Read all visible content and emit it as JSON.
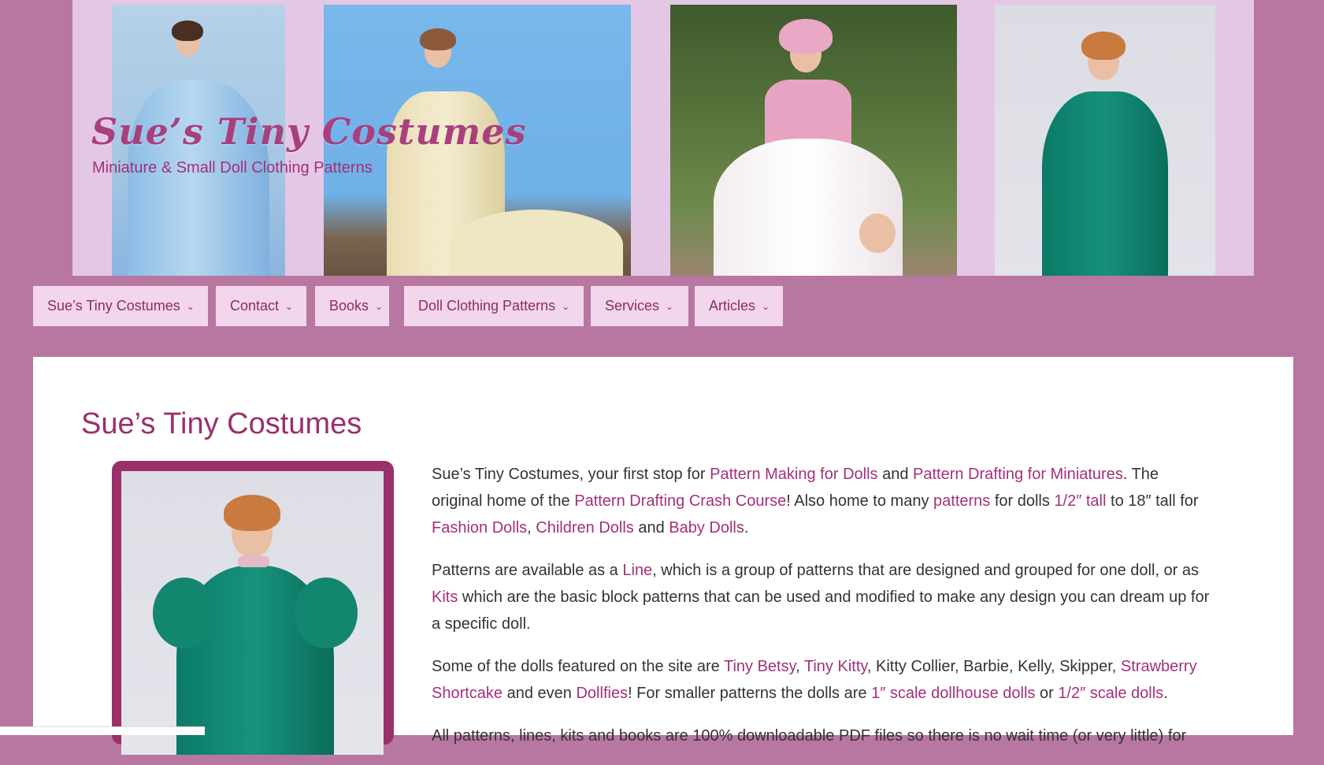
{
  "header": {
    "site_title": "Sue’s Tiny Costumes",
    "tagline": "Miniature & Small Doll Clothing Patterns"
  },
  "social": [
    {
      "icon": "youtube-icon"
    },
    {
      "icon": "twitter-icon"
    },
    {
      "icon": "rss-icon"
    }
  ],
  "nav": {
    "items": [
      {
        "label": "Sue’s Tiny Costumes"
      },
      {
        "label": "Contact"
      },
      {
        "label": "Books"
      },
      {
        "label": "Doll Clothing Patterns"
      },
      {
        "label": "Services"
      },
      {
        "label": "Articles"
      }
    ]
  },
  "main": {
    "title": "Sue’s Tiny Costumes",
    "p1": {
      "t1": "Sue’s Tiny Costumes, your first stop for ",
      "l1": "Pattern Making for Dolls",
      "t2": " and ",
      "l2": "Pattern Drafting for Miniatures",
      "t3": ". The original home of the ",
      "l3": "Pattern Drafting Crash Course",
      "t4": "! Also home to many ",
      "l4": "patterns",
      "t5": " for dolls ",
      "l5": "1/2″ tall",
      "t6": " to 18″ tall for ",
      "l6": "Fashion Dolls",
      "t7": ", ",
      "l7": "Children Dolls",
      "t8": " and ",
      "l8": "Baby Dolls",
      "t9": "."
    },
    "p2": {
      "t1": "Patterns are available as a ",
      "l1": "Line",
      "t2": ", which is a group of patterns that are designed and grouped for one doll, or as ",
      "l2": "Kits",
      "t3": " which are the basic block patterns that can be used and modified to make any design you can dream up for a specific doll."
    },
    "p3": {
      "t1": "Some of the dolls featured on the site are ",
      "l1": "Tiny Betsy",
      "t2": ", ",
      "l2": "Tiny Kitty",
      "t3": ", Kitty Collier, Barbie, Kelly, Skipper, ",
      "l3": "Strawberry Shortcake",
      "t4": " and even ",
      "l4": "Dollfies",
      "t5": "! For smaller patterns the dolls are ",
      "l5": "1″ scale dollhouse dolls",
      "t6": " or ",
      "l6": "1/2″ scale dolls",
      "t7": "."
    },
    "p4": "All patterns, lines, kits and books are 100% downloadable PDF files so there is no wait time (or very little) for"
  },
  "colors": {
    "background": "#b877a0",
    "header_bg": "#e4c7e4",
    "nav_bg": "#f2d6ec",
    "link": "#a3307a",
    "title": "#9b2f6e",
    "frame": "#9a2f69"
  }
}
